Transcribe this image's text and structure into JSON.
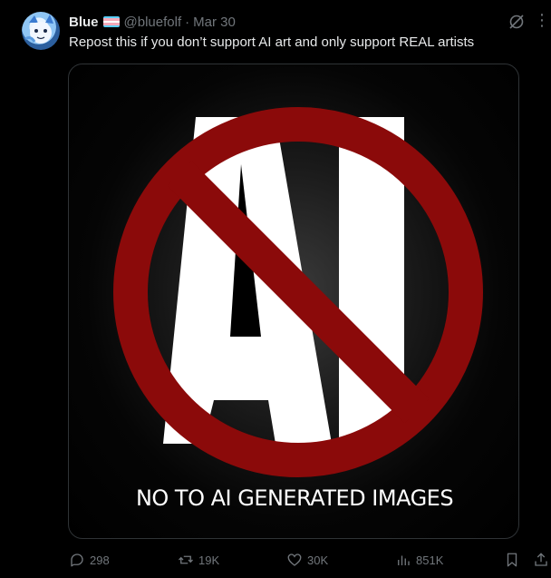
{
  "tweet": {
    "author_name": "Blue",
    "handle": "@bluefolf",
    "separator": "·",
    "date": "Mar 30",
    "text": "Repost this if you don’t support AI art and only support REAL artists",
    "more_glyph": "⋮"
  },
  "media": {
    "big_letters": "AI",
    "caption": "NO TO AI GENERATED IMAGES",
    "ban_color": "#8b0a0a"
  },
  "flag_colors": [
    "#5bcefa",
    "#f5a9b8",
    "#ffffff",
    "#f5a9b8",
    "#5bcefa"
  ],
  "actions": {
    "replies": "298",
    "reposts": "19K",
    "likes": "30K",
    "views": "851K"
  },
  "icons": {
    "reply": "reply-icon",
    "repost": "repost-icon",
    "like": "heart-icon",
    "views": "views-icon",
    "bookmark": "bookmark-icon",
    "share": "share-icon",
    "grok": "grok-icon",
    "more": "more-icon"
  }
}
